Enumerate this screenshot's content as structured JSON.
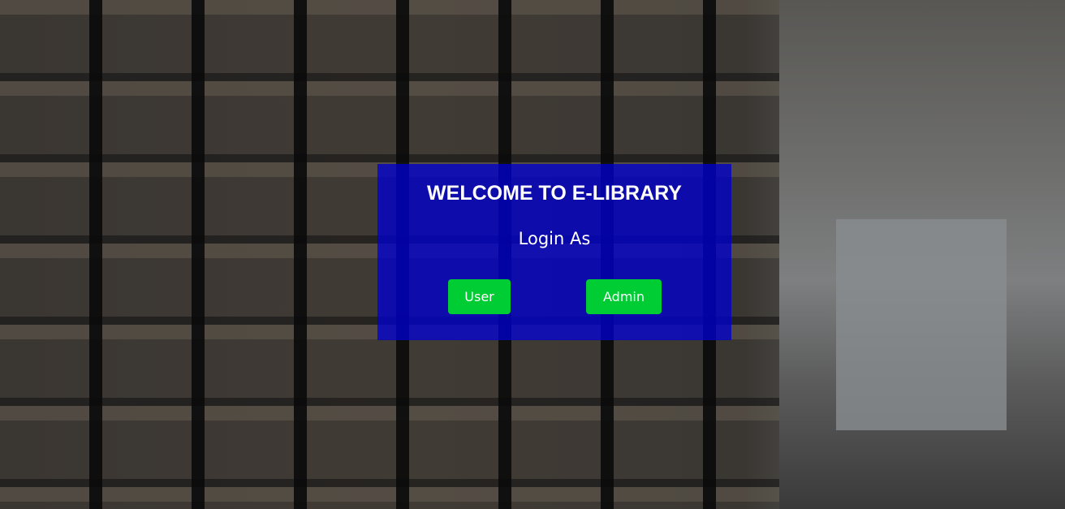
{
  "login": {
    "title": "WELCOME TO E-LIBRARY",
    "subtitle": "Login As",
    "user_button": "User",
    "admin_button": "Admin"
  },
  "colors": {
    "panel": "#0000cd",
    "button": "#00cc33"
  }
}
